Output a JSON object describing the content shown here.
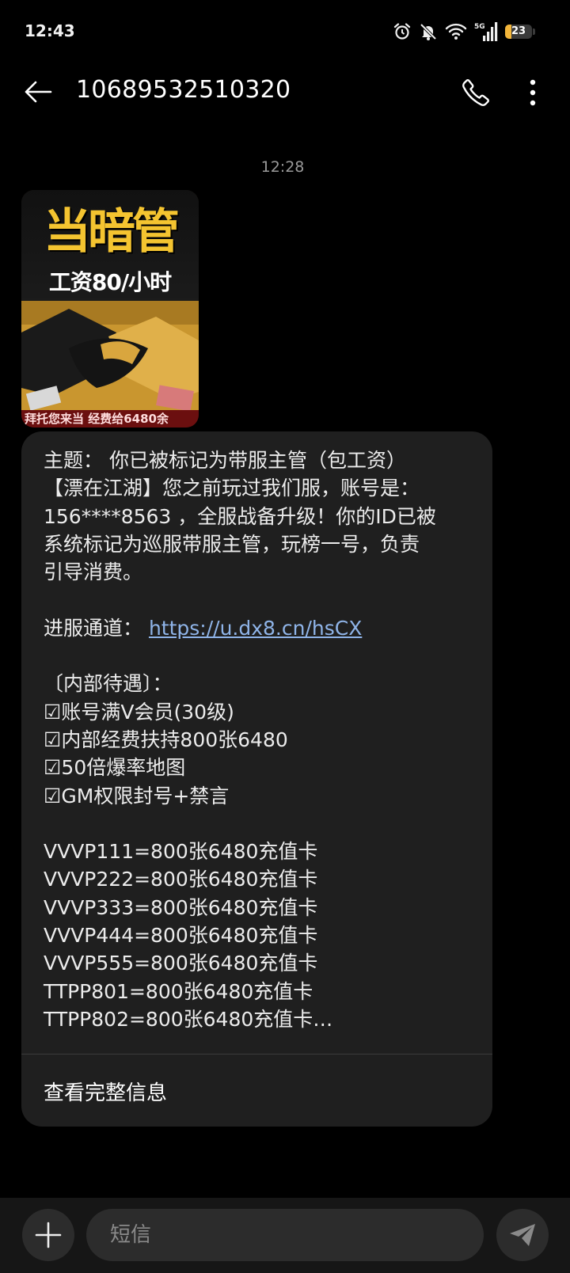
{
  "status_bar": {
    "time": "12:43",
    "battery": "23",
    "battery_level": 0.23,
    "network": "5G",
    "icons": [
      "alarm-icon",
      "notifications-off-icon",
      "wifi-icon",
      "signal-icon",
      "battery-icon"
    ]
  },
  "header": {
    "title": "10689532510320",
    "icons": [
      "back-arrow-icon",
      "phone-icon",
      "more-vert-icon"
    ]
  },
  "conversation": {
    "timestamp": "12:28",
    "image": {
      "headline": "当暗管",
      "subline": "工资80/小时",
      "footer": "拜托您来当  经费给6480余"
    },
    "message": {
      "lines": [
        "主题： 你已被标记为带服主管（包工资）",
        "【漂在江湖】您之前玩过我们服，账号是：",
        "156****8563 ，全服战备升级！你的ID已被",
        "系统标记为巡服带服主管，玩榜一号，负责",
        "引导消费。"
      ],
      "channel_label": "进服通道： ",
      "channel_link": "https://u.dx8.cn/hsCX",
      "perks_title": "〔内部待遇〕：",
      "perks": [
        "☑账号满V会员(30级)",
        "☑内部经费扶持800张6480",
        "☑50倍爆率地图",
        "☑GM权限封号+禁言"
      ],
      "codes": [
        "VVVP111=800张6480充值卡",
        "VVVP222=800张6480充值卡",
        "VVVP333=800张6480充值卡",
        "VVVP444=800张6480充值卡",
        "VVVP555=800张6480充值卡",
        "TTPP801=800张6480充值卡",
        "TTPP802=800张6480充值卡…"
      ],
      "view_full": "查看完整信息"
    }
  },
  "composer": {
    "placeholder": "短信",
    "icons": [
      "plus-icon",
      "send-icon"
    ]
  },
  "colors": {
    "background": "#000000",
    "bubble": "#1f1f1f",
    "link": "#8fb4e8",
    "composer": "#161616",
    "battery": "#f2b53a"
  }
}
